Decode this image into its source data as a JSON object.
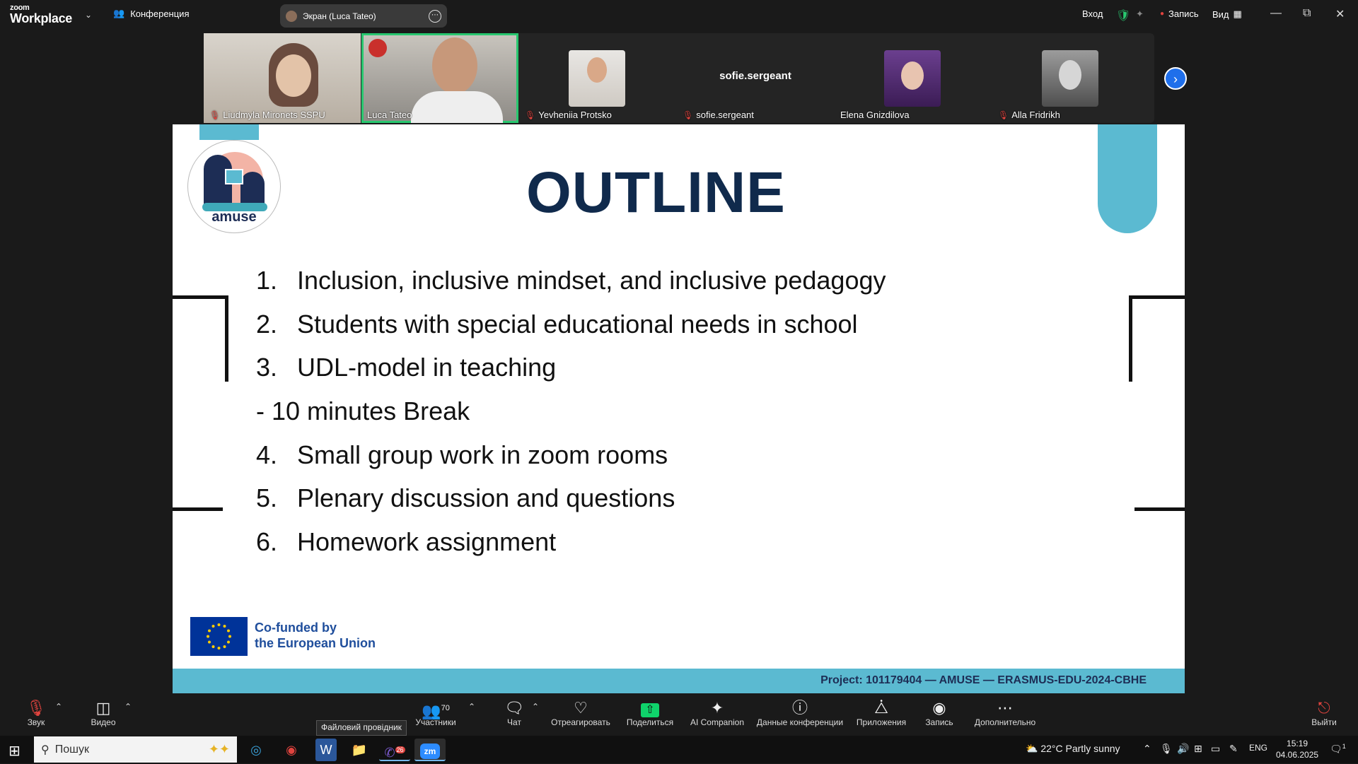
{
  "titlebar": {
    "brand_small": "zoom",
    "brand_big": "Workplace",
    "meeting_label": "Конференция",
    "share_label": "Экран (Luca Tateo)",
    "signin": "Вход",
    "record": "Запись",
    "view": "Вид"
  },
  "participants": [
    {
      "name": "Liudmyla Mironets SSPU",
      "muted": true
    },
    {
      "name": "Luca Tateo",
      "muted": false,
      "active": true
    },
    {
      "name": "Yevheniia Protsko",
      "muted": true
    },
    {
      "name": "sofie.sergeant",
      "muted": true,
      "display": "sofie.sergeant"
    },
    {
      "name": "Elena Gnizdilova",
      "muted": false
    },
    {
      "name": "Alla Fridrikh",
      "muted": true
    }
  ],
  "slide": {
    "logo_text": "amuse",
    "title": "OUTLINE",
    "items": [
      {
        "num": "1.",
        "text": "Inclusion, inclusive mindset, and inclusive pedagogy"
      },
      {
        "num": "2.",
        "text": "Students with special educational needs in school"
      },
      {
        "num": "3.",
        "text": "UDL-model in teaching"
      },
      {
        "num": "",
        "text": "- 10 minutes Break"
      },
      {
        "num": "4.",
        "text": "Small group work in zoom rooms"
      },
      {
        "num": "5.",
        "text": "Plenary discussion and questions"
      },
      {
        "num": "6.",
        "text": "Homework assignment"
      }
    ],
    "eu_line1": "Co-funded by",
    "eu_line2": "the European Union",
    "footer": "Project: 101179404 — AMUSE — ERASMUS-EDU-2024-CBHE"
  },
  "toolbar": {
    "audio": "Звук",
    "video": "Видео",
    "participants": "Участники",
    "participants_count": "70",
    "chat": "Чат",
    "react": "Отреагировать",
    "share": "Поделиться",
    "ai": "AI Companion",
    "info": "Данные конференции",
    "apps": "Приложения",
    "record": "Запись",
    "more": "Дополнительно",
    "leave": "Выйти",
    "tooltip": "Файловий провідник"
  },
  "taskbar": {
    "search_placeholder": "Пошук",
    "weather": "22°C  Partly sunny",
    "lang": "ENG",
    "time": "15:19",
    "date": "04.06.2025",
    "viber_badge": "26",
    "notif_count": "1"
  },
  "colors": {
    "accent_teal": "#5bbad1",
    "title_navy": "#102a4c",
    "active_speaker": "#28c76f",
    "share_green": "#0fd36b",
    "eu_blue": "#003399"
  }
}
